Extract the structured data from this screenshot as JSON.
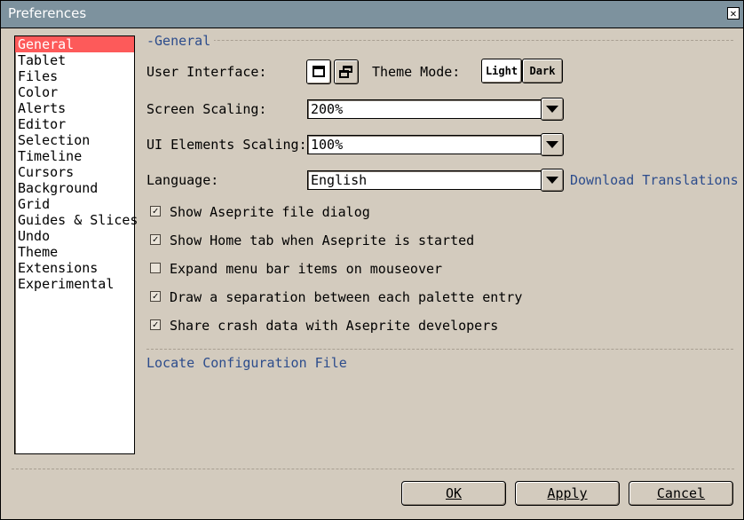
{
  "window": {
    "title": "Preferences"
  },
  "sidebar": {
    "items": [
      {
        "label": "General",
        "selected": true
      },
      {
        "label": "Tablet"
      },
      {
        "label": "Files"
      },
      {
        "label": "Color"
      },
      {
        "label": "Alerts"
      },
      {
        "label": "Editor"
      },
      {
        "label": "Selection"
      },
      {
        "label": "Timeline"
      },
      {
        "label": "Cursors"
      },
      {
        "label": "Background"
      },
      {
        "label": "Grid"
      },
      {
        "label": "Guides & Slices"
      },
      {
        "label": "Undo"
      },
      {
        "label": "Theme"
      },
      {
        "label": "Extensions"
      },
      {
        "label": "Experimental"
      }
    ]
  },
  "general": {
    "legend": "General",
    "ui_label": "User Interface:",
    "ui_modes": [
      "single-window-icon",
      "multiple-windows-icon"
    ],
    "theme_mode_label": "Theme Mode:",
    "theme_light": "Light",
    "theme_dark": "Dark",
    "screen_scaling_label": "Screen Scaling:",
    "screen_scaling_value": "200%",
    "ui_scaling_label": "UI Elements Scaling:",
    "ui_scaling_value": "100%",
    "language_label": "Language:",
    "language_value": "English",
    "download_translations": "Download Translations",
    "checks": [
      {
        "label": "Show Aseprite file dialog",
        "checked": true
      },
      {
        "label": "Show Home tab when Aseprite is started",
        "checked": true
      },
      {
        "label": "Expand menu bar items on mouseover",
        "checked": false
      },
      {
        "label": "Draw a separation between each palette entry",
        "checked": true
      },
      {
        "label": "Share crash data with Aseprite developers",
        "checked": true
      }
    ],
    "locate_config": "Locate Configuration File"
  },
  "buttons": {
    "ok": "OK",
    "apply": "Apply",
    "cancel": "Cancel"
  },
  "colors": {
    "titlebar": "#7d929e",
    "selected": "#fd5a5a",
    "link": "#2c4c8c",
    "background": "#d3cbbe"
  }
}
